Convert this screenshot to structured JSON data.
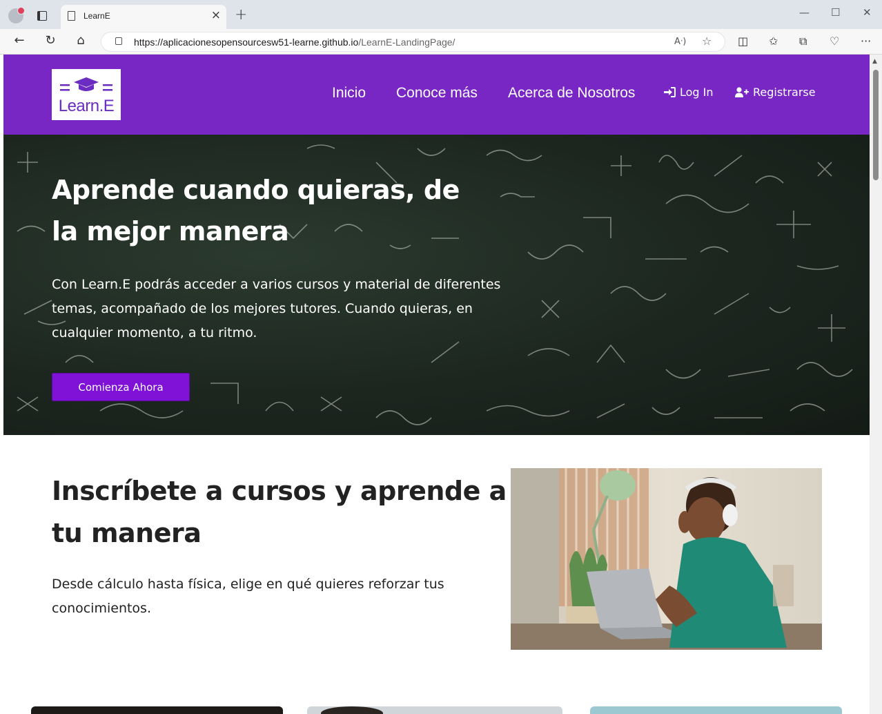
{
  "browser": {
    "tab_title": "LearnE",
    "url_host": "https://aplicacionesopensourcesw51-learne.github.io",
    "url_path": "/LearnE-LandingPage/"
  },
  "header": {
    "logo_text": "Learn.E",
    "nav": [
      "Inicio",
      "Conoce más",
      "Acerca de Nosotros"
    ],
    "login": "Log In",
    "register": "Registrarse"
  },
  "hero": {
    "title": "Aprende cuando quieras, de la mejor manera",
    "text": "Con Learn.E podrás acceder a varios cursos y material de diferentes temas, acompañado de los mejores tutores. Cuando quieras, en cualquier momento, a tu ritmo.",
    "cta": "Comienza Ahora"
  },
  "section": {
    "title": "Inscríbete a cursos y aprende a tu manera",
    "text": "Desde cálculo hasta física, elige en qué quieres reforzar tus conocimientos."
  },
  "colors": {
    "accent": "#7826c4",
    "button": "#7f12d6"
  }
}
